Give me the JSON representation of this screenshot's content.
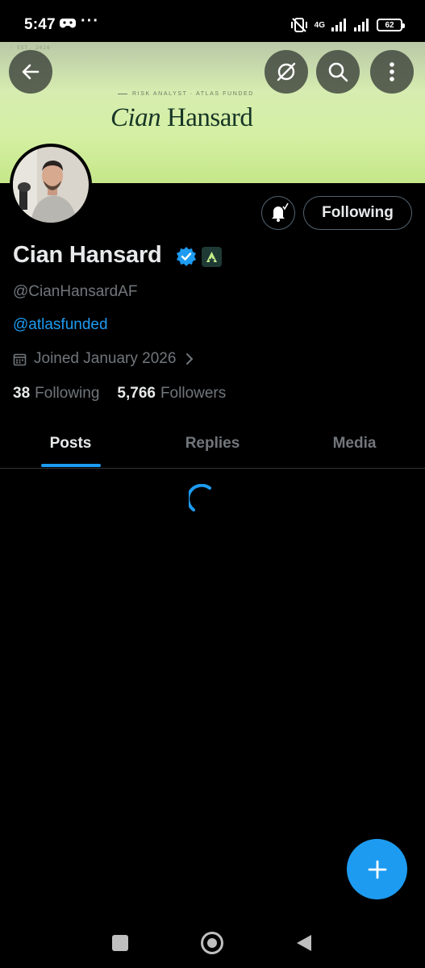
{
  "status_bar": {
    "time": "5:47",
    "dots": "···",
    "network": "4G",
    "battery": "62"
  },
  "banner": {
    "est_text": "· EST. 2026",
    "tagline": "RISK ANALYST · ATLAS FUNDED",
    "name_first": "Cian",
    "name_last": " Hansard",
    "colors": {
      "top": "#b9c8a7",
      "bottom": "#c5e789",
      "text": "#173626"
    }
  },
  "header_buttons": {
    "back_icon": "arrow-left-icon",
    "grok_icon": "grok-icon",
    "search_icon": "search-icon",
    "more_icon": "more-vertical-icon"
  },
  "profile": {
    "display_name": "Cian Hansard",
    "handle": "@CianHansardAF",
    "bio_link": "@atlasfunded",
    "joined": "Joined January 2026",
    "following_count": "38",
    "following_label": "Following",
    "followers_count": "5,766",
    "followers_label": "Followers",
    "follow_button": "Following",
    "verified_color": "#1d9bf0"
  },
  "tabs": [
    {
      "label": "Posts",
      "active": true
    },
    {
      "label": "Replies",
      "active": false
    },
    {
      "label": "Media",
      "active": false
    }
  ],
  "colors": {
    "accent": "#1d9bf0",
    "background": "#000000",
    "text_primary": "#e7e9ea",
    "text_secondary": "#71767b"
  }
}
